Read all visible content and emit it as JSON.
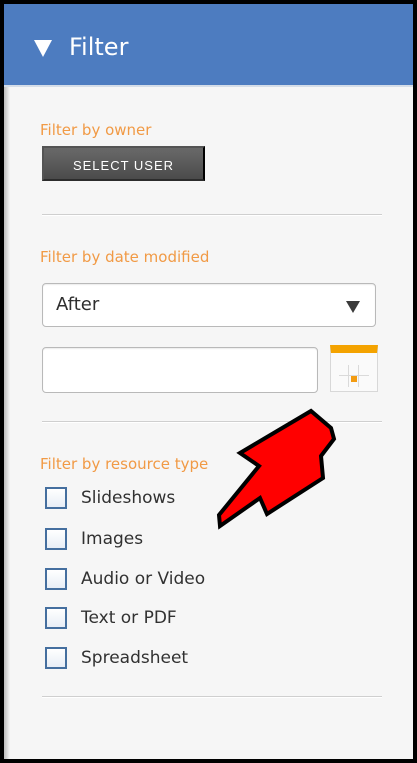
{
  "panel": {
    "title": "Filter",
    "header_color": "#4d7cc0",
    "accent_label_color": "#f19a45"
  },
  "filters": {
    "owner": {
      "label": "Filter by owner",
      "button_label": "SELECT USER"
    },
    "date_modified": {
      "label": "Filter by date modified",
      "selected_option": "After",
      "date_value": "",
      "date_placeholder": "",
      "icon": "calendar-icon"
    },
    "resource_type": {
      "label": "Filter by resource type",
      "options": [
        {
          "label": "Slideshows",
          "checked": false
        },
        {
          "label": "Images",
          "checked": false
        },
        {
          "label": "Audio or Video",
          "checked": false
        },
        {
          "label": "Text or PDF",
          "checked": false
        },
        {
          "label": "Spreadsheet",
          "checked": false
        }
      ]
    }
  },
  "annotation": {
    "icon": "red-pointer-arrow",
    "color": "#ff0000"
  }
}
